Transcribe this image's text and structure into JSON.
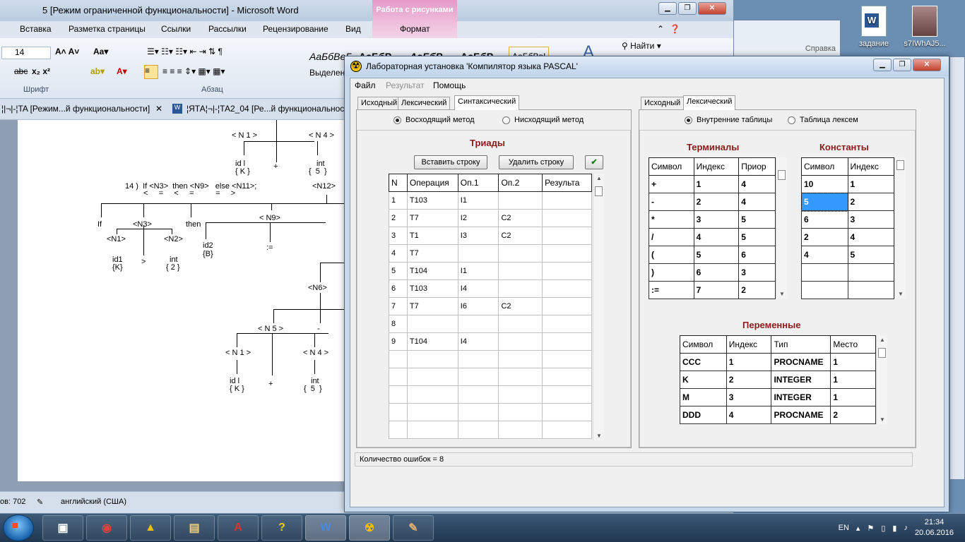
{
  "word": {
    "title": "5 [Режим ограниченной функциональности]  -  Microsoft Word",
    "context_tab": "Работа с рисунками",
    "ribbon_tabs": [
      "Вставка",
      "Разметка страницы",
      "Ссылки",
      "Рассылки",
      "Рецензирование",
      "Вид",
      "Формат"
    ],
    "font_size": "14",
    "groups": [
      "Шрифт",
      "Абзац"
    ],
    "style_samples": [
      "АаБбВеГ",
      "АаБбВ",
      "АаБбВ",
      "АаБбВ",
      "АаБбВвІ"
    ],
    "style_gallery_label": "Выделени",
    "find_label": "Найти",
    "doc_tabs": [
      "¦|¬|-¦TA [Режим...й функциональности]",
      "¦ЯТА¦¬|-¦ТА2_04 [Ре...й функциональност"
    ],
    "status_words": "ов: 702",
    "status_lang": "английский (США)",
    "help_label": "Справка"
  },
  "tree": {
    "rule": "14 )  If <N3>  then <N9>   else <N11>;",
    "rule_marks": "<     =     <     =          =     >",
    "labels": [
      "< N 1 >",
      "< N 4 >",
      "id l",
      "{ K }",
      "+",
      "int",
      "{  5  }",
      "<N12>",
      "If",
      "<N3>",
      "then",
      "< N9>",
      "<N1>",
      "<N2>",
      "id1",
      "{K}",
      ">",
      "int",
      "{ 2 }",
      "id2",
      "{B}",
      ":=",
      "<N6>",
      "< N 5 >",
      "-",
      "< N 1 >",
      "< N 4 >",
      "id l",
      "{ K }",
      "+",
      "int",
      "{  5  }"
    ]
  },
  "desktop": {
    "icons": [
      {
        "label": "задание",
        "icon": "word-document-icon"
      },
      {
        "label": "s7IWhAJ5...",
        "icon": "image-file-icon"
      }
    ]
  },
  "taskbar": {
    "lang": "EN",
    "time": "21:34",
    "date": "20.06.2016",
    "apps": [
      "save-disk-icon",
      "chrome-icon",
      "triangle-app-icon",
      "explorer-folder-icon",
      "pdf-icon",
      "help-icon",
      "word-icon",
      "radiation-app-icon",
      "paint-icon"
    ]
  },
  "app": {
    "title": "Лабораторная установка 'Компилятор языка PASCAL'",
    "menu": [
      "Файл",
      "Результат",
      "Помощь"
    ],
    "left": {
      "tabs": [
        "Исходный",
        "Лексический",
        "Синтаксический"
      ],
      "radios": [
        "Восходящий метод",
        "Нисходящий метод"
      ],
      "title": "Триады",
      "btn_insert": "Вставить строку",
      "btn_delete": "Удалить строку",
      "btn_check": "✔",
      "columns": [
        "N",
        "Операция",
        "Оп.1",
        "Оп.2",
        "Результа"
      ],
      "rows": [
        [
          "1",
          "T103",
          "I1",
          "",
          ""
        ],
        [
          "2",
          "T7",
          "I2",
          "C2",
          ""
        ],
        [
          "3",
          "T1",
          "I3",
          "C2",
          ""
        ],
        [
          "4",
          "T7",
          "",
          "",
          ""
        ],
        [
          "5",
          "T104",
          "I1",
          "",
          ""
        ],
        [
          "6",
          "T103",
          "I4",
          "",
          ""
        ],
        [
          "7",
          "T7",
          "I6",
          "C2",
          ""
        ],
        [
          "8",
          "",
          "",
          "",
          ""
        ],
        [
          "9",
          "T104",
          "I4",
          "",
          ""
        ],
        [
          "",
          "",
          "",
          "",
          ""
        ],
        [
          "",
          "",
          "",
          "",
          ""
        ],
        [
          "",
          "",
          "",
          "",
          ""
        ],
        [
          "",
          "",
          "",
          "",
          ""
        ],
        [
          "",
          "",
          "",
          "",
          ""
        ]
      ]
    },
    "right": {
      "tabs": [
        "Исходный",
        "Лексический"
      ],
      "radios": [
        "Внутренние таблицы",
        "Таблица лексем"
      ],
      "terminals_title": "Терминалы",
      "terminals_columns": [
        "Символ",
        "Индекс",
        "Приор"
      ],
      "terminals_rows": [
        [
          "+",
          "1",
          "4"
        ],
        [
          "-",
          "2",
          "4"
        ],
        [
          "*",
          "3",
          "5"
        ],
        [
          "/",
          "4",
          "5"
        ],
        [
          "(",
          "5",
          "6"
        ],
        [
          ")",
          "6",
          "3"
        ],
        [
          ":=",
          "7",
          "2"
        ]
      ],
      "constants_title": "Константы",
      "constants_columns": [
        "Символ",
        "Индекс"
      ],
      "constants_rows": [
        [
          "10",
          "1"
        ],
        [
          "5",
          "2"
        ],
        [
          "6",
          "3"
        ],
        [
          "2",
          "4"
        ],
        [
          "4",
          "5"
        ],
        [
          "",
          ""
        ],
        [
          "",
          ""
        ]
      ],
      "variables_title": "Переменные",
      "variables_columns": [
        "Символ",
        "Индекс",
        "Тип",
        "Место"
      ],
      "variables_rows": [
        [
          "CCC",
          "1",
          "PROCNAME",
          "1"
        ],
        [
          "K",
          "2",
          "INTEGER",
          "1"
        ],
        [
          "M",
          "3",
          "INTEGER",
          "1"
        ],
        [
          "DDD",
          "4",
          "PROCNAME",
          "2"
        ]
      ]
    },
    "status": "Количество ошибок = 8"
  }
}
